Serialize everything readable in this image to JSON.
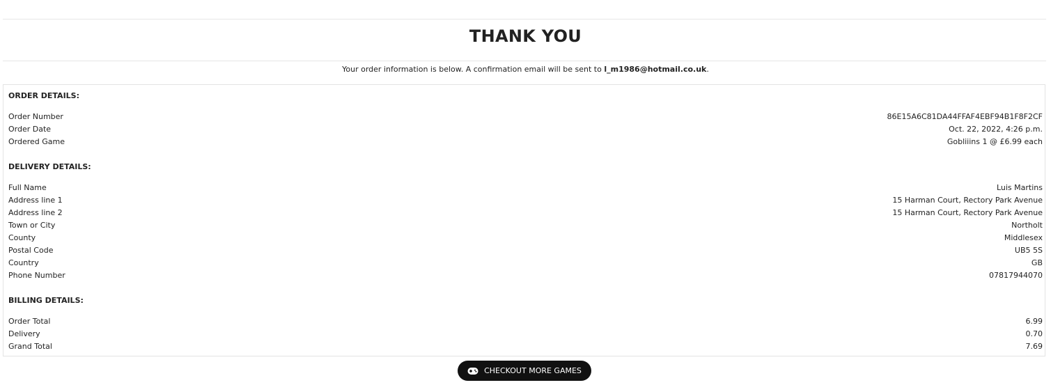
{
  "header": {
    "title": "THANK YOU",
    "subtitle_prefix": "Your order information is below. A confirmation email will be sent to ",
    "email": "l_m1986@hotmail.co.uk",
    "subtitle_suffix": "."
  },
  "order": {
    "section_title": "ORDER DETAILS:",
    "rows": [
      {
        "label": "Order Number",
        "value": "86E15A6C81DA44FFAF4EBF94B1F8F2CF"
      },
      {
        "label": "Order Date",
        "value": "Oct. 22, 2022, 4:26 p.m."
      },
      {
        "label": "Ordered Game",
        "value": "Gobliiins 1 @ £6.99 each"
      }
    ]
  },
  "delivery": {
    "section_title": "DELIVERY DETAILS:",
    "rows": [
      {
        "label": "Full Name",
        "value": "Luis Martins"
      },
      {
        "label": "Address line 1",
        "value": "15 Harman Court, Rectory Park Avenue"
      },
      {
        "label": "Address line 2",
        "value": "15 Harman Court, Rectory Park Avenue"
      },
      {
        "label": "Town or City",
        "value": "Northolt"
      },
      {
        "label": "County",
        "value": "Middlesex"
      },
      {
        "label": "Postal Code",
        "value": "UB5 5S"
      },
      {
        "label": "Country",
        "value": "GB"
      },
      {
        "label": "Phone Number",
        "value": "07817944070"
      }
    ]
  },
  "billing": {
    "section_title": "BILLING DETAILS:",
    "rows": [
      {
        "label": "Order Total",
        "value": "6.99"
      },
      {
        "label": "Delivery",
        "value": "0.70"
      },
      {
        "label": "Grand Total",
        "value": "7.69"
      }
    ]
  },
  "button": {
    "label": "CHECKOUT MORE GAMES",
    "icon": "gamepad-icon"
  }
}
